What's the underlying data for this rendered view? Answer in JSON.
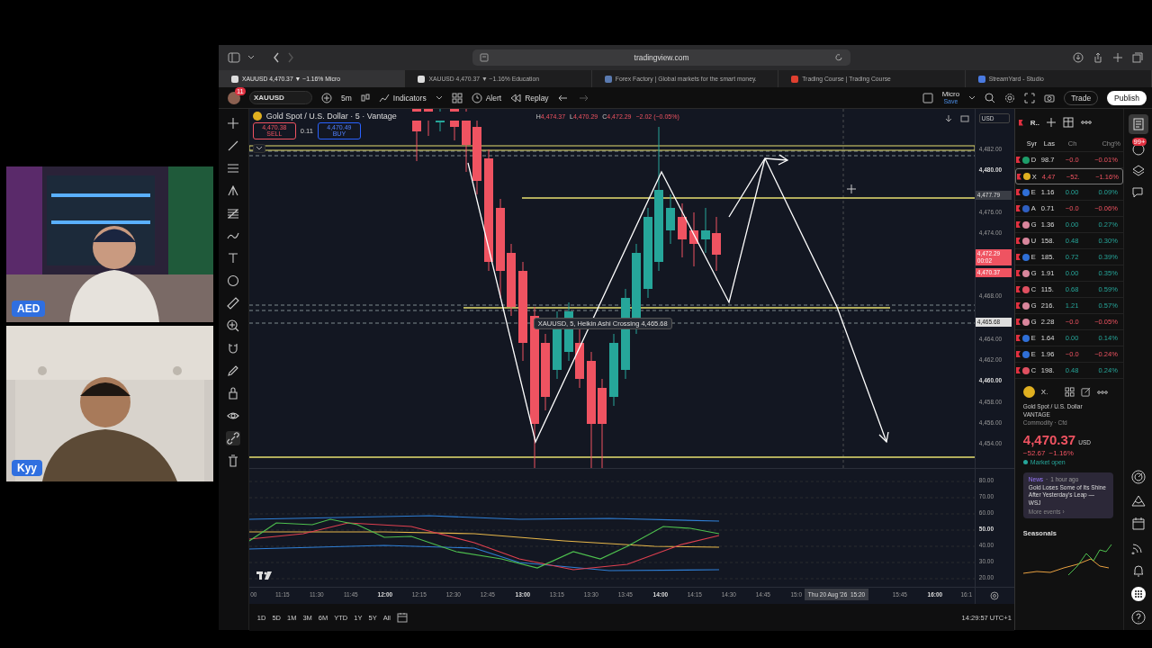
{
  "webcams": [
    {
      "label": "AED"
    },
    {
      "label": "Kyy"
    }
  ],
  "browser": {
    "url": "tradingview.com",
    "tabs": [
      {
        "title": "XAUUSD 4,470.37 ▼ −1.16% Micro",
        "selected": true
      },
      {
        "title": "XAUUSD 4,470.37 ▼ −1.16% Education",
        "selected": false
      },
      {
        "title": "Forex Factory | Global markets for the smart money.",
        "selected": false
      },
      {
        "title": "Trading Course | Trading Course",
        "selected": false
      },
      {
        "title": "StreamYard - Studio",
        "selected": false
      }
    ]
  },
  "toolbar": {
    "badge": "11",
    "symbol": "XAUUSD",
    "interval": "5m",
    "indicators": "Indicators",
    "alert": "Alert",
    "replay": "Replay",
    "layout": "Micro",
    "layout_status": "Save",
    "trade": "Trade",
    "publish": "Publish"
  },
  "chart": {
    "title": "Gold Spot / U.S. Dollar · 5 · Vantage",
    "ohlc": [
      {
        "label": "H",
        "value": "4,474.37"
      },
      {
        "label": "L",
        "value": "4,470.29"
      },
      {
        "label": "C",
        "value": "4,472.29"
      }
    ],
    "change": "−2.02 (−0.05%)",
    "sell": {
      "price": "4,470.38",
      "label": "SELL"
    },
    "spread": "0.11",
    "buy": {
      "price": "4,470.49",
      "label": "BUY"
    },
    "alert_label": "XAUUSD, 5, Heikin Ashi Crossing 4,465.68",
    "currency": "USD",
    "price_ticks": [
      {
        "label": "4,482.00",
        "major": false
      },
      {
        "label": "4,480.00",
        "major": true
      },
      {
        "label": "4,476.00",
        "major": false
      },
      {
        "label": "4,474.00",
        "major": false
      },
      {
        "label": "4,468.00",
        "major": false
      },
      {
        "label": "4,464.00",
        "major": false
      },
      {
        "label": "4,462.00",
        "major": false
      },
      {
        "label": "4,460.00",
        "major": true
      },
      {
        "label": "4,458.00",
        "major": false
      },
      {
        "label": "4,456.00",
        "major": false
      },
      {
        "label": "4,454.00",
        "major": false
      }
    ],
    "price_labels": [
      {
        "kind": "line",
        "text": "4,477.79"
      },
      {
        "kind": "last",
        "text": "4,472.29",
        "sub": "00:02"
      },
      {
        "kind": "last",
        "text": "4,470.37"
      },
      {
        "kind": "alert",
        "text": "4,465.68"
      }
    ],
    "oscillator_ticks": [
      {
        "label": "80.00",
        "major": false
      },
      {
        "label": "70.00",
        "major": false
      },
      {
        "label": "60.00",
        "major": false
      },
      {
        "label": "50.00",
        "major": true
      },
      {
        "label": "40.00",
        "major": false
      },
      {
        "label": "30.00",
        "major": false
      },
      {
        "label": "20.00",
        "major": false
      }
    ],
    "time_ticks": [
      {
        "label": "00",
        "major": false
      },
      {
        "label": "11:15",
        "major": false
      },
      {
        "label": "11:30",
        "major": false
      },
      {
        "label": "11:45",
        "major": false
      },
      {
        "label": "12:00",
        "major": true
      },
      {
        "label": "12:15",
        "major": false
      },
      {
        "label": "12:30",
        "major": false
      },
      {
        "label": "12:45",
        "major": false
      },
      {
        "label": "13:00",
        "major": true
      },
      {
        "label": "13:15",
        "major": false
      },
      {
        "label": "13:30",
        "major": false
      },
      {
        "label": "13:45",
        "major": false
      },
      {
        "label": "14:00",
        "major": true
      },
      {
        "label": "14:15",
        "major": false
      },
      {
        "label": "14:30",
        "major": false
      },
      {
        "label": "14:45",
        "major": false
      },
      {
        "label": "15:0",
        "major": false
      },
      {
        "label": "15:45",
        "major": false
      },
      {
        "label": "16:00",
        "major": true
      },
      {
        "label": "16:1",
        "major": false
      }
    ],
    "crosshair_label": "Thu 20 Aug '26  15:20",
    "ranges": [
      "1D",
      "5D",
      "1M",
      "3M",
      "6M",
      "YTD",
      "1Y",
      "5Y",
      "All"
    ],
    "clock": "14:29:57 UTC+1"
  },
  "watchlist": {
    "title": "R..",
    "columns": [
      "Syr",
      "Las",
      "Ch",
      "Chg%"
    ],
    "rows": [
      {
        "symbol": "D",
        "last": "98.7",
        "change": "−0.0",
        "change_pct": "−0.01%",
        "negative": true,
        "selected": false,
        "color": "#1e9e6a"
      },
      {
        "symbol": "X",
        "last": "4,47",
        "change": "−52.",
        "change_pct": "−1.16%",
        "negative": true,
        "selected": true,
        "color": "#e0b020"
      },
      {
        "symbol": "E",
        "last": "1.16",
        "change": "0.00",
        "change_pct": "0.09%",
        "negative": false,
        "selected": false,
        "color": "#2f6fd6"
      },
      {
        "symbol": "A",
        "last": "0.71",
        "change": "−0.0",
        "change_pct": "−0.06%",
        "negative": true,
        "selected": false,
        "color": "#2f5fc0"
      },
      {
        "symbol": "G",
        "last": "1.36",
        "change": "0.00",
        "change_pct": "0.27%",
        "negative": false,
        "selected": false,
        "color": "#d9869c"
      },
      {
        "symbol": "U",
        "last": "158.",
        "change": "0.48",
        "change_pct": "0.30%",
        "negative": false,
        "selected": false,
        "color": "#d9869c"
      },
      {
        "symbol": "E",
        "last": "185.",
        "change": "0.72",
        "change_pct": "0.39%",
        "negative": false,
        "selected": false,
        "color": "#2f6fd6"
      },
      {
        "symbol": "G",
        "last": "1.91",
        "change": "0.00",
        "change_pct": "0.35%",
        "negative": false,
        "selected": false,
        "color": "#d9869c"
      },
      {
        "symbol": "C",
        "last": "115.",
        "change": "0.68",
        "change_pct": "0.59%",
        "negative": false,
        "selected": false,
        "color": "#e05060"
      },
      {
        "symbol": "G",
        "last": "216.",
        "change": "1.21",
        "change_pct": "0.57%",
        "negative": false,
        "selected": false,
        "color": "#d9869c"
      },
      {
        "symbol": "G",
        "last": "2.28",
        "change": "−0.0",
        "change_pct": "−0.05%",
        "negative": true,
        "selected": false,
        "color": "#d9869c"
      },
      {
        "symbol": "E",
        "last": "1.64",
        "change": "0.00",
        "change_pct": "0.14%",
        "negative": false,
        "selected": false,
        "color": "#2f6fd6"
      },
      {
        "symbol": "E",
        "last": "1.96",
        "change": "−0.0",
        "change_pct": "−0.24%",
        "negative": true,
        "selected": false,
        "color": "#2f6fd6"
      },
      {
        "symbol": "C",
        "last": "198.",
        "change": "0.48",
        "change_pct": "0.24%",
        "negative": false,
        "selected": false,
        "color": "#e05060"
      }
    ]
  },
  "details": {
    "symbol": "X.",
    "name": "Gold Spot / U.S. Dollar",
    "exchange": "VANTAGE",
    "type": "Commodity · Cfd",
    "price": "4,470.37",
    "currency": "USD",
    "change": "−52.67",
    "change_pct": "−1.16%",
    "status": "Market open",
    "news": {
      "tag": "News",
      "separator": "·",
      "time": "1 hour ago",
      "headline": "Gold Loses Some of Its Shine After Yesterday's Leap — WSJ",
      "more": "More events ›"
    },
    "seasonals": "Seasonals"
  },
  "sidebar": {
    "notification_badge": "99+"
  }
}
